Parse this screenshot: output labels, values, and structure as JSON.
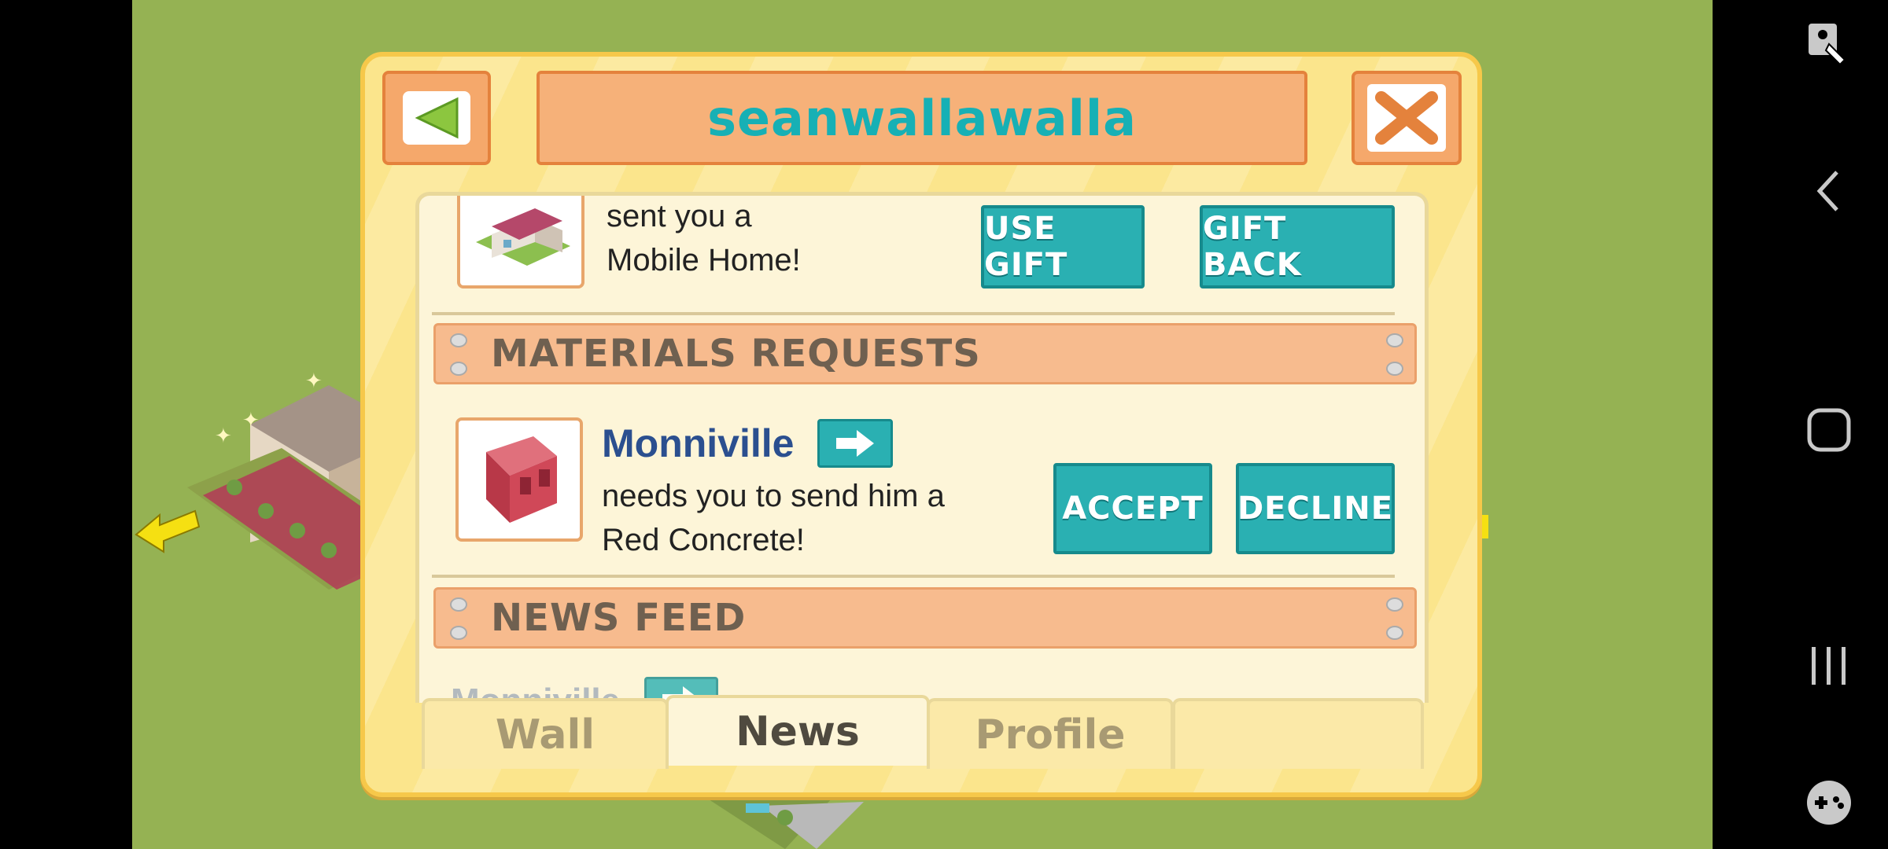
{
  "header": {
    "username": "seanwallawalla"
  },
  "gift_item": {
    "line1": "sent you a",
    "line2": "Mobile Home!",
    "use_gift_label": "USE GIFT",
    "gift_back_label": "GIFT BACK"
  },
  "materials_section": {
    "title": "MATERIALS REQUESTS"
  },
  "materials_item": {
    "name": "Monniville",
    "line1": "needs you to send him a",
    "line2": "Red Concrete!",
    "accept_label": "ACCEPT",
    "decline_label": "DECLINE"
  },
  "news_section": {
    "title": "NEWS FEED"
  },
  "news_peek": {
    "name": "Monniville"
  },
  "tabs": [
    {
      "label": "Wall",
      "active": false
    },
    {
      "label": "News",
      "active": true
    },
    {
      "label": "Profile",
      "active": false
    },
    {
      "label": "",
      "active": false
    }
  ],
  "colors": {
    "teal": "#2ab0b2",
    "title_teal": "#17b0b5",
    "panel_bg": "#fbe58c",
    "orange_header": "#f6b179",
    "name_blue": "#2b4f8f",
    "grass": "#95b253"
  },
  "android_nav": {
    "icons": [
      "accessibility-icon",
      "back-icon",
      "home-icon",
      "recents-icon",
      "game-controller-icon"
    ]
  }
}
